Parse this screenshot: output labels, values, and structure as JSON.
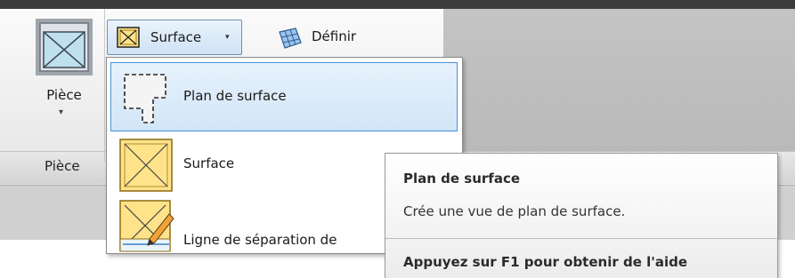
{
  "ribbon": {
    "piece_button": {
      "label": "Pièce",
      "arrow": "▾",
      "icon": "room-icon"
    },
    "panel_title": "Pièce",
    "surface_button": {
      "label": "Surface",
      "arrow": "▾",
      "icon": "area-icon"
    },
    "definir_button": {
      "label": "Définir",
      "icon": "grid-icon"
    }
  },
  "dropdown": {
    "items": [
      {
        "label": "Plan de surface",
        "icon": "area-plan-icon",
        "highlighted": true
      },
      {
        "label": "Surface",
        "icon": "area-icon",
        "highlighted": false
      },
      {
        "label": "Ligne de séparation de",
        "icon": "area-boundary-icon",
        "highlighted": false
      }
    ]
  },
  "tooltip": {
    "title": "Plan de surface",
    "description": "Crée une vue de plan de surface.",
    "help": "Appuyez sur F1 pour obtenir de l'aide"
  },
  "colors": {
    "highlight_border": "#4a90d9",
    "highlight_fill": "#d2e6f8",
    "area_fill": "#ffe38a",
    "area_stroke": "#b08a2a"
  }
}
